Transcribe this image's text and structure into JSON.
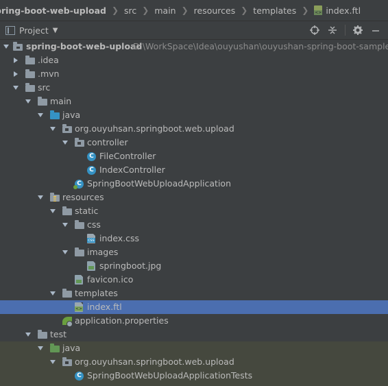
{
  "breadcrumb": {
    "items": [
      {
        "label": "pring-boot-web-upload"
      },
      {
        "label": "src"
      },
      {
        "label": "main"
      },
      {
        "label": "resources"
      },
      {
        "label": "templates"
      },
      {
        "label": "index.ftl"
      }
    ]
  },
  "toolwindow": {
    "title": "Project",
    "actions": [
      "crosshair-icon",
      "collapse-all-icon",
      "gear-icon",
      "minimize-icon"
    ]
  },
  "tree": {
    "root": {
      "label": "spring-boot-web-upload",
      "path": "D:\\WorkSpace\\Idea\\ouyushan\\ouyushan-spring-boot-samples\\"
    },
    "nodes": [
      {
        "label": ".idea"
      },
      {
        "label": ".mvn"
      },
      {
        "label": "src"
      },
      {
        "label": "main"
      },
      {
        "label": "java"
      },
      {
        "label": "org.ouyuhsan.springboot.web.upload"
      },
      {
        "label": "controller"
      },
      {
        "label": "FileController"
      },
      {
        "label": "IndexController"
      },
      {
        "label": "SpringBootWebUploadApplication"
      },
      {
        "label": "resources"
      },
      {
        "label": "static"
      },
      {
        "label": "css"
      },
      {
        "label": "index.css"
      },
      {
        "label": "images"
      },
      {
        "label": "springboot.jpg"
      },
      {
        "label": "favicon.ico"
      },
      {
        "label": "templates"
      },
      {
        "label": "index.ftl"
      },
      {
        "label": "application.properties"
      },
      {
        "label": "test"
      },
      {
        "label": "java"
      },
      {
        "label": "org.ouyuhsan.springboot.web.upload"
      },
      {
        "label": "SpringBootWebUploadApplicationTests"
      }
    ]
  },
  "colors": {
    "background": "#3c3f41",
    "selection": "#4b6eaf",
    "test_background": "#45483e",
    "source_folder": "#3592c4",
    "test_folder": "#629755"
  }
}
